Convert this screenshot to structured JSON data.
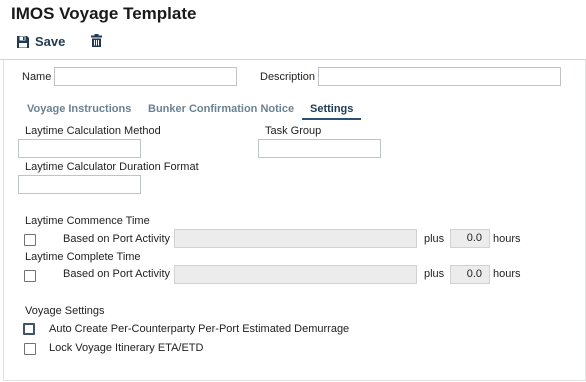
{
  "page": {
    "title": "IMOS Voyage Template"
  },
  "toolbar": {
    "save_label": "Save",
    "delete_icon": "trash-icon",
    "save_icon": "floppy-disk-icon"
  },
  "form": {
    "name_label": "Name",
    "name_value": "",
    "description_label": "Description",
    "description_value": ""
  },
  "tabs": [
    {
      "label": "Voyage Instructions",
      "active": false
    },
    {
      "label": "Bunker Confirmation Notice",
      "active": false
    },
    {
      "label": "Settings",
      "active": true
    }
  ],
  "settings": {
    "laytime_calc_method_label": "Laytime Calculation Method",
    "laytime_calc_method_value": "",
    "task_group_label": "Task Group",
    "task_group_value": "",
    "duration_format_label": "Laytime Calculator Duration Format",
    "duration_format_value": "",
    "commence": {
      "heading": "Laytime Commence Time",
      "checkbox_label": "Based on Port Activity",
      "checked": false,
      "activity_value": "",
      "plus_label": "plus",
      "hours_value": "0.0",
      "hours_label": "hours"
    },
    "complete": {
      "heading": "Laytime Complete Time",
      "checkbox_label": "Based on Port Activity",
      "checked": false,
      "activity_value": "",
      "plus_label": "plus",
      "hours_value": "0.0",
      "hours_label": "hours"
    },
    "voyage_settings": {
      "heading": "Voyage Settings",
      "items": [
        {
          "label": "Auto Create Per-Counterparty Per-Port Estimated Demurrage",
          "checked": false
        },
        {
          "label": "Lock Voyage Itinerary ETA/ETD",
          "checked": false
        }
      ]
    }
  },
  "colors": {
    "accent": "#1f3a52",
    "tab_inactive": "#6b8294",
    "disabled_bg": "#ececec"
  }
}
